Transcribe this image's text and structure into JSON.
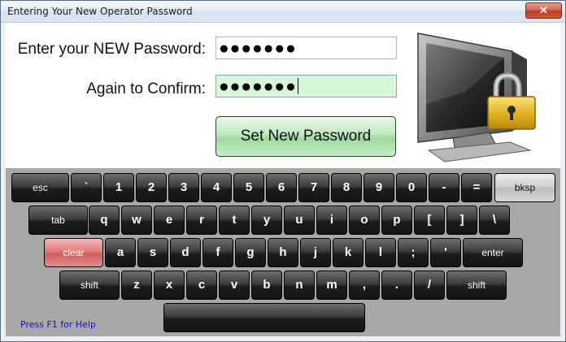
{
  "window": {
    "title": "Entering Your New Operator Password",
    "close_glyph": "✕"
  },
  "form": {
    "new_password_label": "Enter your NEW Password:",
    "new_password_value": "●●●●●●●",
    "confirm_label": "Again to Confirm:",
    "confirm_value": "●●●●●●●",
    "set_button_label": "Set New Password"
  },
  "illustration": {
    "icon": "monitor-padlock-icon"
  },
  "keyboard": {
    "row1": [
      "esc",
      "`",
      "1",
      "2",
      "3",
      "4",
      "5",
      "6",
      "7",
      "8",
      "9",
      "0",
      "-",
      "=",
      "bksp"
    ],
    "row2": [
      "tab",
      "q",
      "w",
      "e",
      "r",
      "t",
      "y",
      "u",
      "i",
      "o",
      "p",
      "[",
      "]",
      "\\"
    ],
    "row3": [
      "clear",
      "a",
      "s",
      "d",
      "f",
      "g",
      "h",
      "j",
      "k",
      "l",
      ";",
      "'",
      "enter"
    ],
    "row4": [
      "shift",
      "z",
      "x",
      "c",
      "v",
      "b",
      "n",
      "m",
      ",",
      ".",
      "/",
      "shift"
    ],
    "space_label": ""
  },
  "help": {
    "text": "Press F1 for Help"
  },
  "colors": {
    "confirm_field_bg": "#d6f8d6",
    "set_button_bg": "#bfe8bf",
    "clear_key_bg": "#e47d7d",
    "help_text": "#1010cc"
  }
}
